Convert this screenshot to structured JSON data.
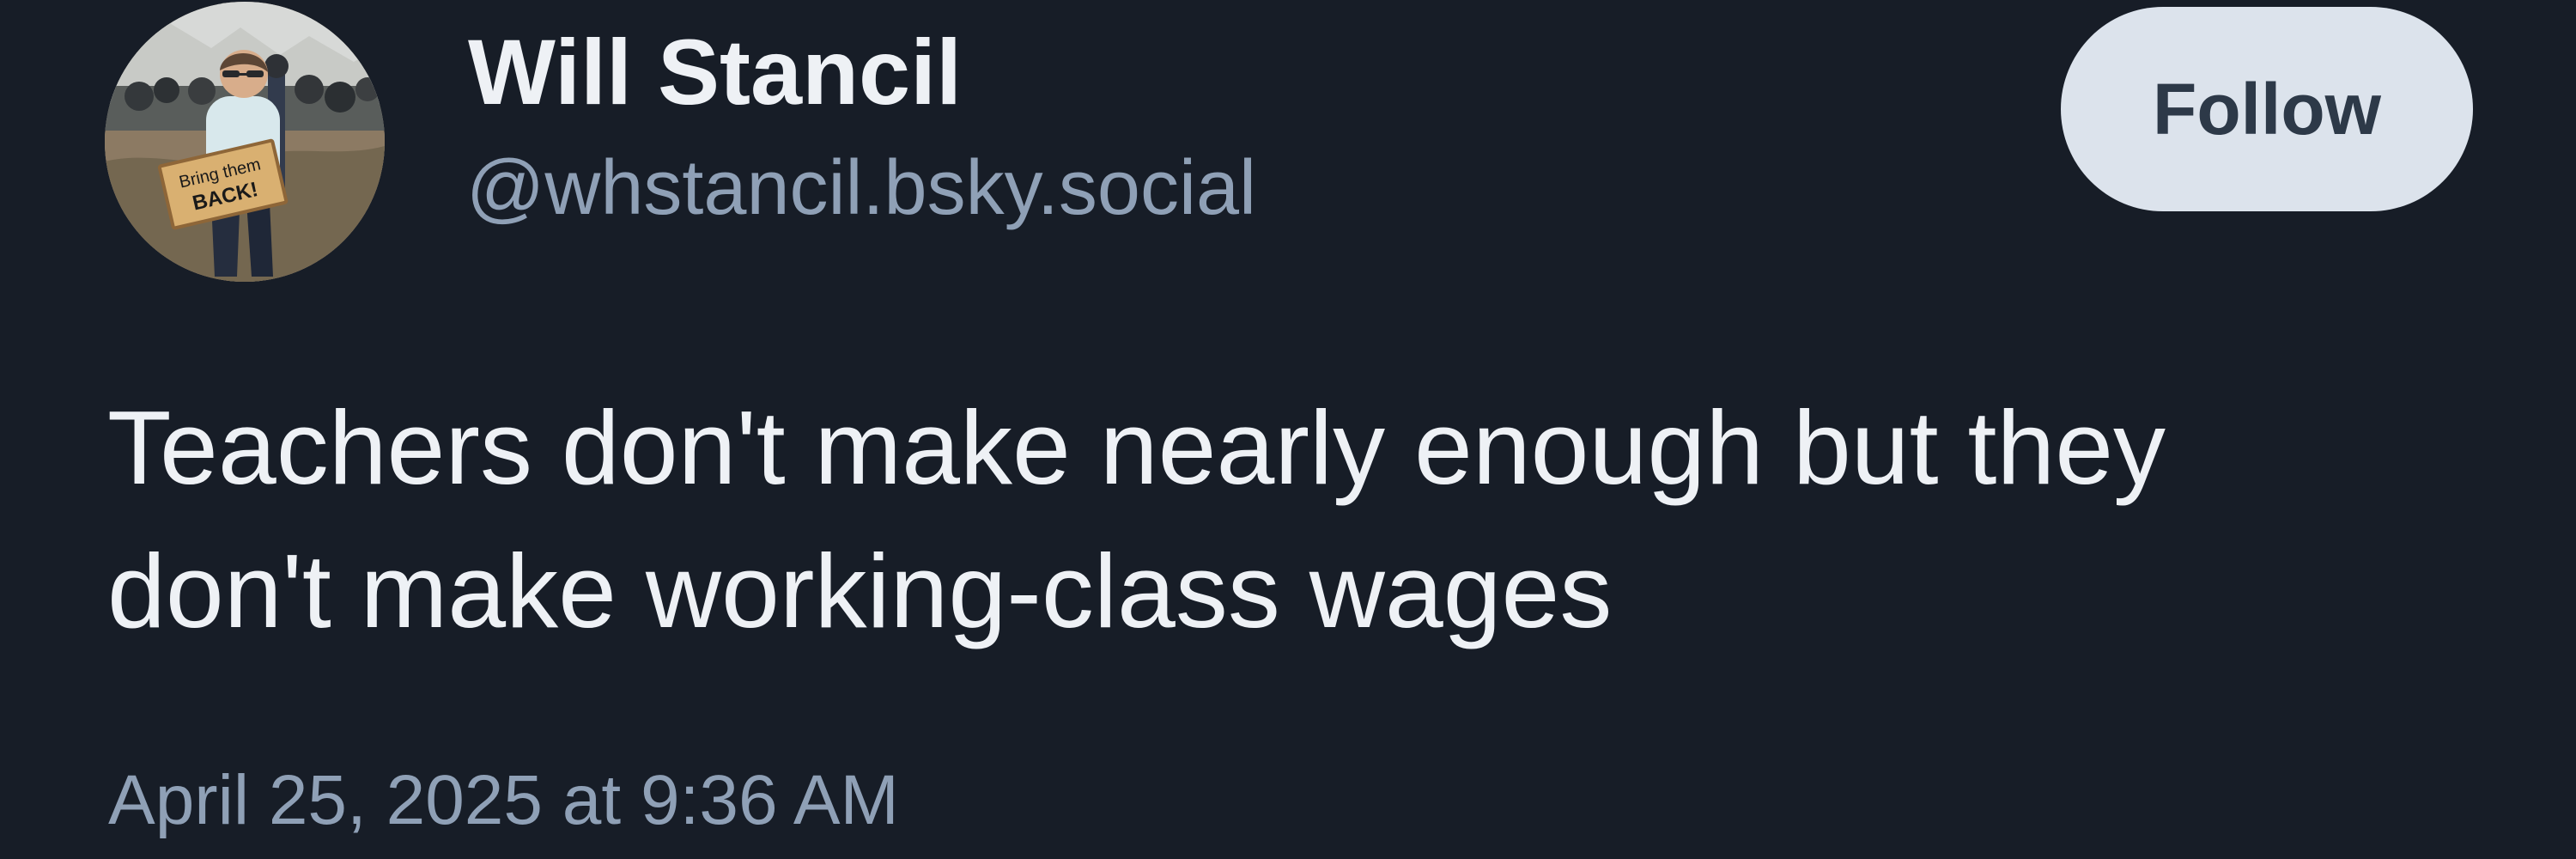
{
  "author": {
    "name": "Will Stancil",
    "handle": "@whstancil.bsky.social",
    "avatar_icon": "profile-photo",
    "avatar_sign_text_1": "Bring them",
    "avatar_sign_text_2": "BACK!"
  },
  "follow_button": {
    "label": "Follow"
  },
  "post": {
    "text_lines": [
      "Teachers don't make nearly enough but they",
      "don't make working-class wages"
    ],
    "timestamp": "April 25, 2025 at 9:36 AM"
  },
  "colors": {
    "background": "#171d27",
    "primary_text": "#eef1f5",
    "secondary_text": "#8fa0b6",
    "button_background": "#dce3ec",
    "button_text": "#2d3948"
  }
}
